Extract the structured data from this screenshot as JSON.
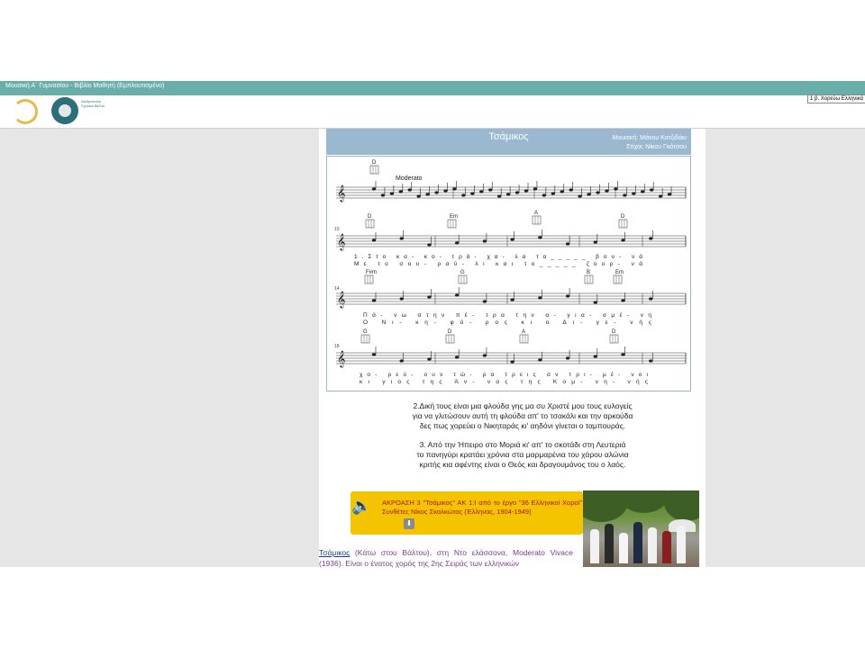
{
  "window": {
    "title": "Μουσική Α΄ Γυμνασίου - Βιβλίο Μαθητή (Εμπλουτισμένο)",
    "logo_text": "Διαδραστικά Σχολικά Βιβλία"
  },
  "nav": {
    "selected_chapter": "1 β. Χορεύω Ελληνικά"
  },
  "song": {
    "title": "Τσάμικος",
    "music_credit": "Μουσική: Μάνου Κατζιδάκι",
    "lyrics_credit": "Στίχοι: Νίκου Γκάτσου",
    "tempo": "Moderato",
    "chords_line1": [
      "D"
    ],
    "chords_line2": [
      "D",
      "Em",
      "A",
      "D"
    ],
    "chords_line3": [
      "F#m",
      "G",
      "B",
      "Em"
    ],
    "chords_line4": [
      "G",
      "D",
      "A",
      "D"
    ],
    "measure_numbers": [
      "10",
      "14",
      "18"
    ],
    "lyrics_line2a": "1.Στο κα- κο- τρά- χα- λα τα_____ βου- νά",
    "lyrics_line2b": "Με το σου- ραύ- λι και το_____ ζουρ- νά",
    "lyrics_line3a": "Πά- νω στην πέ- τρα την α- για- σμέ- νη",
    "lyrics_line3b": "Ο Νι- κη- φό- ρος κι ο Δι- γε- νής",
    "lyrics_line4a": "χο- ρεύ- ουν τώ- ρα τρεις σν τρι- μέ- νοι",
    "lyrics_line4b": "κι γιος της Άν- νας της Κομ- νη- νής"
  },
  "verses": {
    "verse2": [
      "2.Δική τους είναι μια φλούδα γης μα συ Χριστέ μου τους ευλογείς",
      "για να γλιτώσουν αυτή τη φλούδα απ' το τσακάλι και την αρκούδα",
      "δες πως χορεύει ο Νικηταράς κι' αηδόνι γίνεται ο ταμπουράς."
    ],
    "verse3": [
      "3. Από την Ήπειρο στο Μοριά κι' απ' το σκοτάδι στη Λευτεριά",
      "το πανηγύρι κρατάει χρόνια στα μαρμαρένια του χάρου αλώνια",
      "κριτής κια αφέντης είναι ο Θεός και δραγουμάνος του ο λαός."
    ]
  },
  "audio": {
    "text": "ΑΚΡΟΑΣΗ 3 \"Τσάμικος\" ΑΚ 1:Ι από το έργο \"36 Ελληνικοί Χοροί\" Συνθέτες Νίκος Σκαλκώτας (Έλληνας, 1904-1949)",
    "play_glyph": "⬇"
  },
  "description": {
    "link": "Τσάμικος",
    "text": " (Κάτω στου Βάλτου), στη Ντο ελάσσονα, Moderato Vivace (1936). Είναι ο ένατος χορός της 2ης Σειράς των ελληνικών"
  },
  "colors": {
    "title_bar": "#6aaea9",
    "song_header": "#9ab8cf",
    "audio_box": "#f4c400",
    "audio_text": "#b01515",
    "speaker_icon": "#d23b20"
  }
}
